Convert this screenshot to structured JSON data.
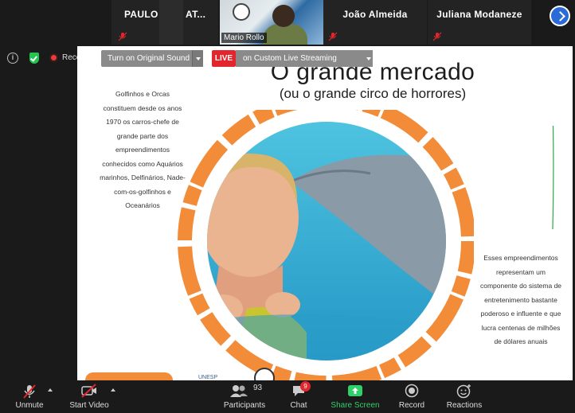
{
  "participants": [
    {
      "name": "PAULO"
    },
    {
      "name": "AT..."
    },
    {
      "name": "João Almeida"
    },
    {
      "name": "Juliana Modaneze"
    }
  ],
  "active_video": {
    "name": "Mario Rollo"
  },
  "meeting": {
    "recording_label": "Reco"
  },
  "streaming": {
    "sound_label": "Turn on Original Sound",
    "live_label": "LIVE",
    "stream_label": "on Custom Live Streaming Service"
  },
  "slide": {
    "title": "O grande mercado",
    "subtitle": "(ou o grande circo de horrores)",
    "left_text": "Golfinhos e Orcas constituem desde os anos 1970 os carros-chefe de grande parte dos empreendimentos conhecidos como Aquários marinhos, Delfinários, Nade-com-os-golfinhos e Oceanários",
    "right_text": "Esses empreendimentos representam um componente do sistema de entretenimento bastante poderoso e influente e que lucra centenas de milhões de dólares anuais",
    "logo_text": "UNESP"
  },
  "toolbar": {
    "unmute": "Unmute",
    "start_video": "Start Video",
    "participants": "Participants",
    "participants_count": "93",
    "chat": "Chat",
    "chat_badge": "9",
    "share_screen": "Share Screen",
    "record": "Record",
    "reactions": "Reactions"
  },
  "colors": {
    "accent": "#2b6bd8",
    "live": "#e3262d",
    "share": "#2fd06a",
    "brush": "#f28c38"
  }
}
